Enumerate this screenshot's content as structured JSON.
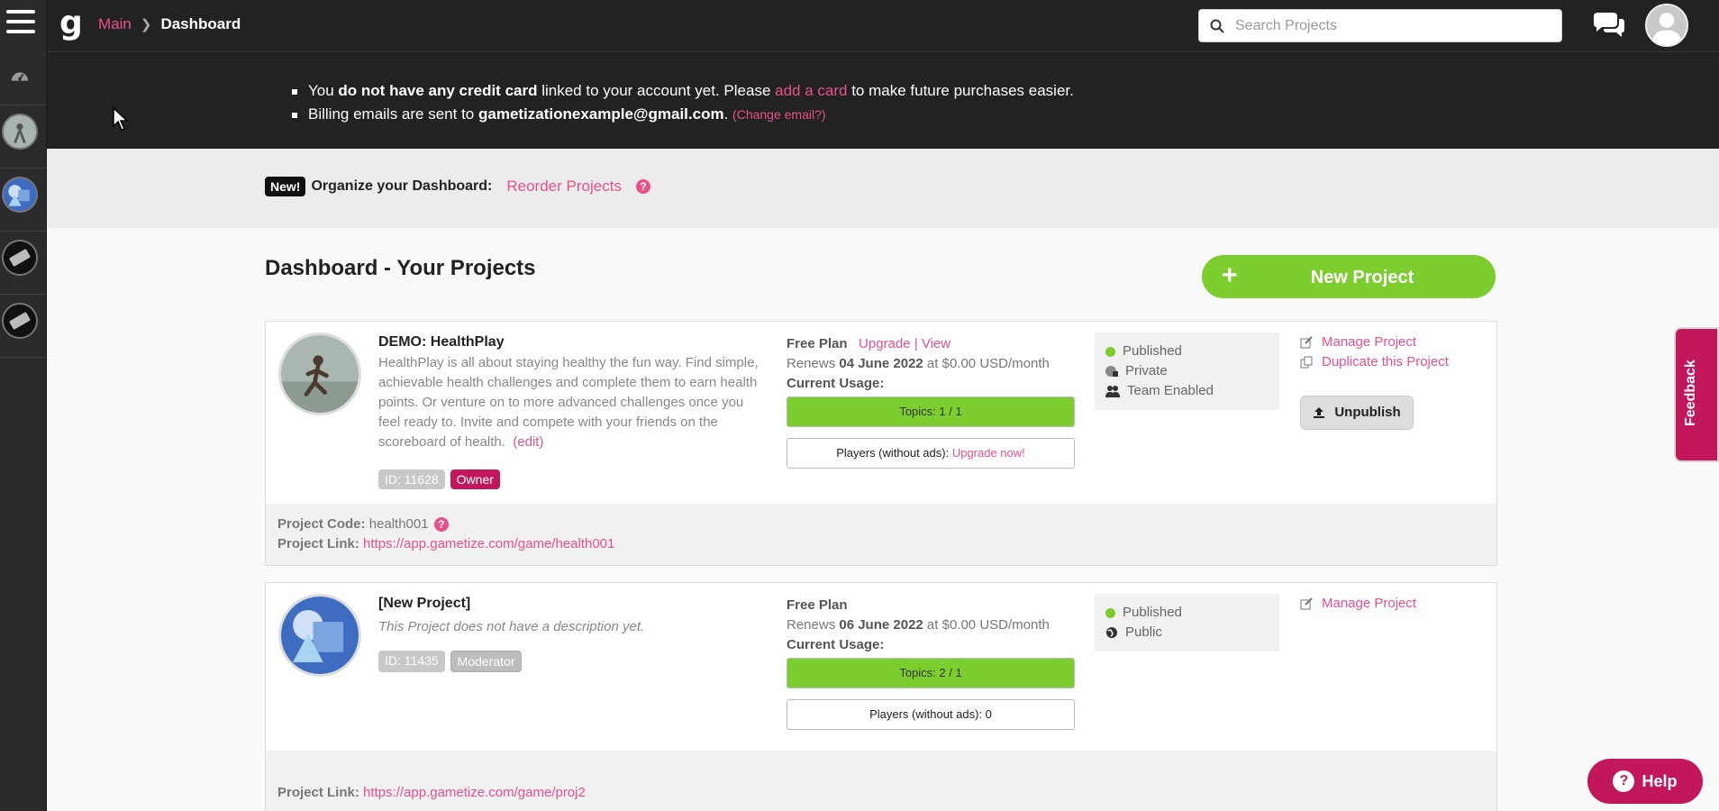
{
  "topbar": {
    "logo": "g",
    "breadcrumb": {
      "main": "Main",
      "current": "Dashboard"
    },
    "search_placeholder": "Search Projects"
  },
  "billing": {
    "line1_a": "You ",
    "line1_b": "do not have any credit card",
    "line1_c": " linked to your account yet. Please ",
    "line1_link": "add a card",
    "line1_d": " to make future purchases easier.",
    "line2_a": "Billing emails are sent to ",
    "line2_email": "gametizationexample@gmail.com",
    "line2_b": ". ",
    "line2_link": "(Change email?)"
  },
  "organize": {
    "badge": "New!",
    "label": "Organize your Dashboard:",
    "link": "Reorder Projects",
    "help": "?"
  },
  "page_title": "Dashboard - Your Projects",
  "new_project": {
    "plus": "+",
    "label": "New Project"
  },
  "projects": [
    {
      "name": "DEMO: HealthPlay",
      "description": "HealthPlay is all about staying healthy the fun way. Find simple, achievable health challenges and complete them to earn health points. Or venture on to more advanced challenges once you feel ready to. Invite and compete with your friends on the scoreboard of health.",
      "edit": "(edit)",
      "id_badge": "ID: 11628",
      "role": "Owner",
      "plan": "Free Plan",
      "upgrade": "Upgrade",
      "divider": "|",
      "view": "View",
      "renews_prefix": "Renews ",
      "renews_date": "04 June 2022",
      "renews_suffix": " at $0.00 USD/month",
      "usage_label": "Current Usage:",
      "topics": "Topics: 1 / 1",
      "topics_fill": 1.0,
      "players_label": "Players (without ads): ",
      "players_link": "Upgrade now!",
      "status": [
        "Published",
        "Private",
        "Team Enabled"
      ],
      "actions": [
        "Manage Project",
        "Duplicate this Project"
      ],
      "unpublish": "Unpublish",
      "code_label": "Project Code:",
      "code": "health001",
      "link_label": "Project Link:",
      "link": "https://app.gametize.com/game/health001"
    },
    {
      "name": "[New Project]",
      "description": "This Project does not have a description yet.",
      "id_badge": "ID: 11435",
      "role": "Moderator",
      "plan": "Free Plan",
      "renews_prefix": "Renews ",
      "renews_date": "06 June 2022",
      "renews_suffix": " at $0.00 USD/month",
      "usage_label": "Current Usage:",
      "topics": "Topics: 2 / 1",
      "players": "Players (without ads): 0",
      "status": [
        "Published",
        "Public"
      ],
      "actions": [
        "Manage Project"
      ],
      "link_label": "Project Link:",
      "link": "https://app.gametize.com/game/proj2"
    }
  ],
  "feedback": "Feedback",
  "help": {
    "q": "?",
    "label": "Help"
  },
  "colors": {
    "accent": "#e8508b",
    "green": "#7ccd2e",
    "owner": "#c2185b",
    "dark": "#222222"
  }
}
